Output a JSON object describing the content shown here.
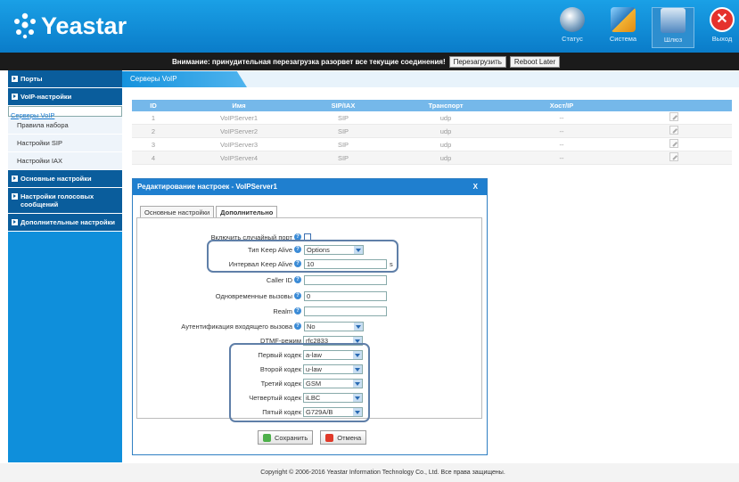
{
  "brand": {
    "logo_text": "Yeastar"
  },
  "topnav": [
    {
      "label": "Статус",
      "icon": "status-icon"
    },
    {
      "label": "Система",
      "icon": "system-icon"
    },
    {
      "label": "Шлюз",
      "icon": "gateway-icon"
    },
    {
      "label": "Выход",
      "icon": "exit-icon"
    }
  ],
  "warning": {
    "text": "Внимание: принудительная перезагрузка разорвет все текущие соединения!",
    "reboot_btn": "Перезагрузить",
    "later_btn": "Reboot Later"
  },
  "sidebar": {
    "ports": "Порты",
    "voip": "VoIP-настройки",
    "voip_items": [
      "Серверы VoIP",
      "Правила набора",
      "Настройки SIP",
      "Настройки IAX"
    ],
    "basic": "Основные настройки",
    "voice": "Настройки голосовых сообщений",
    "advanced": "Дополнительные настройки"
  },
  "breadcrumb": "Серверы VoIP",
  "table": {
    "headers": [
      "ID",
      "Имя",
      "SIP/IAX",
      "Транспорт",
      "Хост/IP"
    ],
    "rows": [
      [
        "1",
        "VoIPServer1",
        "SIP",
        "udp",
        "--"
      ],
      [
        "2",
        "VoIPServer2",
        "SIP",
        "udp",
        "--"
      ],
      [
        "3",
        "VoIPServer3",
        "SIP",
        "udp",
        "--"
      ],
      [
        "4",
        "VoIPServer4",
        "SIP",
        "udp",
        "--"
      ]
    ]
  },
  "dialog": {
    "title": "Редактирование настроек - VoIPServer1",
    "close": "X",
    "tab_basic": "Основные настройки",
    "tab_advanced": "Дополнительно",
    "fields": {
      "random_port": "Включить случайный порт",
      "keepalive_type": "Тип Keep Alive",
      "keepalive_type_val": "Options",
      "keepalive_interval": "Интервал Keep Alive",
      "keepalive_interval_val": "10",
      "keepalive_unit": "s",
      "caller_id": "Caller ID",
      "caller_id_val": "",
      "concurrent": "Одновременные вызовы",
      "concurrent_val": "0",
      "realm": "Realm",
      "realm_val": "",
      "auth_incoming": "Аутентификация входящего вызова",
      "auth_incoming_val": "No",
      "dtmf": "DTMF-режим",
      "dtmf_val": "rfc2833",
      "codec1": "Первый кодек",
      "codec1_val": "a-law",
      "codec2": "Второй кодек",
      "codec2_val": "u-law",
      "codec3": "Третий кодек",
      "codec3_val": "GSM",
      "codec4": "Четвертый кодек",
      "codec4_val": "iLBC",
      "codec5": "Пятый кодек",
      "codec5_val": "G729A/B"
    },
    "save": "Сохранить",
    "cancel": "Отмена"
  },
  "footer": "Copyright © 2006-2016 Yeastar Information Technology Co., Ltd. Все права защищены."
}
